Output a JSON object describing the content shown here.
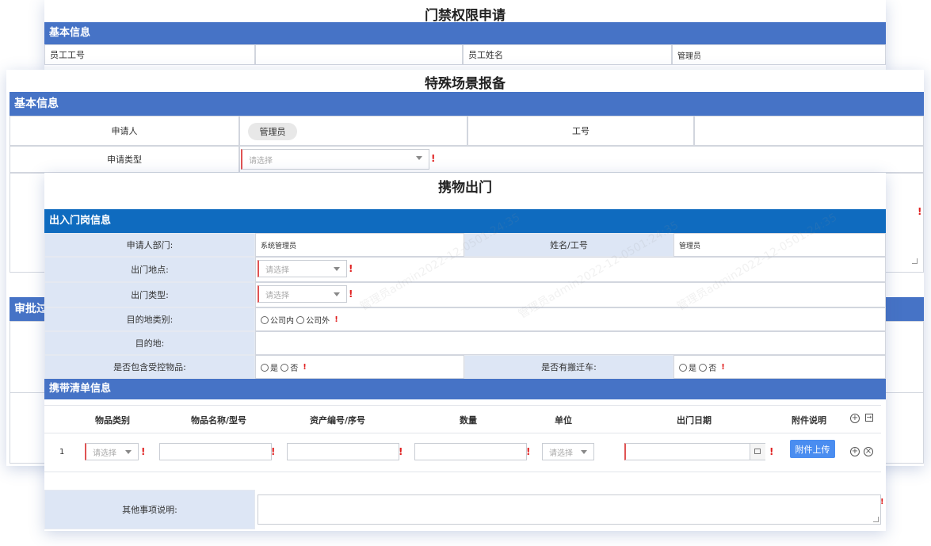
{
  "form1": {
    "title": "门禁权限申请",
    "section": "基本信息",
    "emp_id_label": "员工工号",
    "emp_name_label": "员工姓名",
    "emp_name_value": "管理员"
  },
  "form2": {
    "title": "特殊场景报备",
    "section": "基本信息",
    "applicant_label": "申请人",
    "applicant_value": "管理员",
    "job_no_label": "工号",
    "apply_type_label": "申请类型",
    "apply_type_placeholder": "请选择",
    "approval_section": "审批过"
  },
  "form3": {
    "title": "携物出门",
    "section1": "出入门岗信息",
    "dept_label": "申请人部门:",
    "dept_value": "系统管理员",
    "name_label": "姓名/工号",
    "name_value": "管理员",
    "exit_place_label": "出门地点:",
    "exit_place_placeholder": "请选择",
    "exit_type_label": "出门类型:",
    "exit_type_placeholder": "请选择",
    "dest_type_label": "目的地类别:",
    "dest_opt_in": "公司内",
    "dest_opt_out": "公司外",
    "dest_label": "目的地:",
    "controlled_label": "是否包含受控物品:",
    "yes": "是",
    "no": "否",
    "moving_label": "是否有搬迁车:",
    "section2": "携带清单信息",
    "columns": [
      "物品类别",
      "物品名称/型号",
      "资产编号/序号",
      "数量",
      "单位",
      "出门日期",
      "附件说明"
    ],
    "row_index": "1",
    "row_select_placeholder": "请选择",
    "upload_label": "附件上传",
    "other_label": "其他事项说明:"
  },
  "watermark_text": "管理员admin2022-12-0501:24:35",
  "colors": {
    "section_bar": "#4673c6",
    "section_bar_dark": "#0f6bbf",
    "label_bg": "#dde6f5",
    "required": "#e02020",
    "upload_button": "#4a8df0"
  }
}
